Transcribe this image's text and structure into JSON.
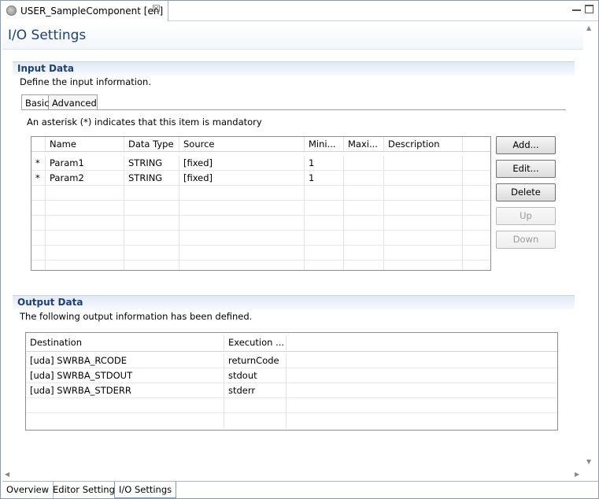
{
  "editor_tab": {
    "title": "USER_SampleComponent [en]",
    "close": "☒"
  },
  "page": {
    "title": "I/O Settings"
  },
  "input_section": {
    "title": "Input Data",
    "description": "Define the input information.",
    "tabs": [
      "Basic",
      "Advanced"
    ],
    "active_tab": "Basic",
    "note": "An asterisk (*) indicates that this item is mandatory",
    "columns": [
      "",
      "Name",
      "Data Type",
      "Source",
      "Mini...",
      "Maxi...",
      "Description"
    ],
    "rows": [
      [
        "*",
        "Param1",
        "STRING",
        "[fixed]",
        "1",
        "",
        ""
      ],
      [
        "*",
        "Param2",
        "STRING",
        "[fixed]",
        "1",
        "",
        ""
      ]
    ],
    "buttons": {
      "add": "Add...",
      "edit": "Edit...",
      "delete": "Delete",
      "up": "Up",
      "down": "Down"
    }
  },
  "output_section": {
    "title": "Output Data",
    "description": "The following output information has been defined.",
    "columns": [
      "Destination",
      "Execution ..."
    ],
    "rows": [
      [
        "[uda] SWRBA_RCODE",
        "returnCode"
      ],
      [
        "[uda] SWRBA_STDOUT",
        "stdout"
      ],
      [
        "[uda] SWRBA_STDERR",
        "stderr"
      ]
    ]
  },
  "bottom_tabs": [
    "Overview",
    "Editor Settings",
    "I/O Settings"
  ],
  "active_bottom_tab": "I/O Settings"
}
